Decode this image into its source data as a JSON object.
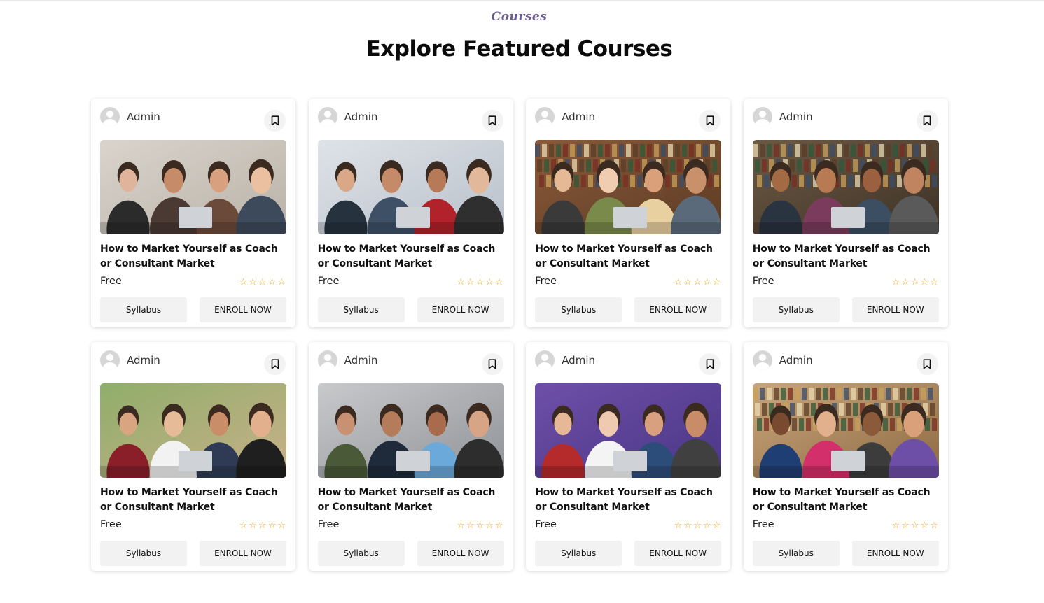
{
  "section": {
    "eyebrow": "Courses",
    "heading": "Explore Featured Courses"
  },
  "icons": {
    "bookmark": "bookmark-icon",
    "avatar": "user-avatar-icon",
    "star": "star-outline-icon"
  },
  "colors": {
    "accent": "#6b5d8f",
    "star": "#e8a317",
    "button_bg": "#f2f2f2"
  },
  "courses": [
    {
      "author": "Admin",
      "title": "How to Market Yourself as Coach or Consultant Market",
      "price": "Free",
      "rating": 5,
      "syllabus_label": "Syllabus",
      "enroll_label": "ENROLL NOW",
      "image": "students-laughing-group"
    },
    {
      "author": "Admin",
      "title": "How to Market Yourself as Coach or Consultant Market",
      "price": "Free",
      "rating": 5,
      "syllabus_label": "Syllabus",
      "enroll_label": "ENROLL NOW",
      "image": "smiling-woman-laptop"
    },
    {
      "author": "Admin",
      "title": "How to Market Yourself as Coach or Consultant Market",
      "price": "Free",
      "rating": 5,
      "syllabus_label": "Syllabus",
      "enroll_label": "ENROLL NOW",
      "image": "library-study"
    },
    {
      "author": "Admin",
      "title": "How to Market Yourself as Coach or Consultant Market",
      "price": "Free",
      "rating": 5,
      "syllabus_label": "Syllabus",
      "enroll_label": "ENROLL NOW",
      "image": "students-with-laptop-library"
    },
    {
      "author": "Admin",
      "title": "How to Market Yourself as Coach or Consultant Market",
      "price": "Free",
      "rating": 5,
      "syllabus_label": "Syllabus",
      "enroll_label": "ENROLL NOW",
      "image": "outdoor-picnic-table"
    },
    {
      "author": "Admin",
      "title": "How to Market Yourself as Coach or Consultant Market",
      "price": "Free",
      "rating": 5,
      "syllabus_label": "Syllabus",
      "enroll_label": "ENROLL NOW",
      "image": "men-reading-books"
    },
    {
      "author": "Admin",
      "title": "How to Market Yourself as Coach or Consultant Market",
      "price": "Free",
      "rating": 5,
      "syllabus_label": "Syllabus",
      "enroll_label": "ENROLL NOW",
      "image": "friends-around-laptop"
    },
    {
      "author": "Admin",
      "title": "How to Market Yourself as Coach or Consultant Market",
      "price": "Free",
      "rating": 5,
      "syllabus_label": "Syllabus",
      "enroll_label": "ENROLL NOW",
      "image": "students-on-sofa"
    }
  ]
}
